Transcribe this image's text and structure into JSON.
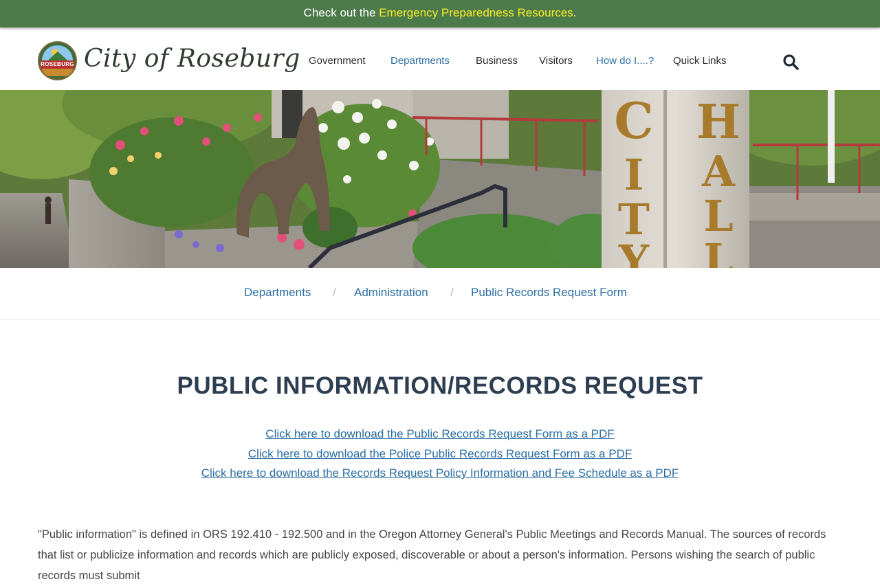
{
  "alert": {
    "prefix": "Check out the ",
    "link": "Emergency Preparedness Resources",
    "suffix": "."
  },
  "logo": {
    "seal_text": "ROSEBURG",
    "title": "City of Roseburg"
  },
  "nav": {
    "items": [
      {
        "label": "Government"
      },
      {
        "label": "Departments"
      },
      {
        "label": "Business"
      },
      {
        "label": "Visitors"
      },
      {
        "label": "How do I....?"
      },
      {
        "label": "Quick Links"
      }
    ]
  },
  "hero": {
    "sign_letters_left": "CITY",
    "sign_letters_right": "HALL"
  },
  "breadcrumb": {
    "items": [
      "Departments",
      "Administration",
      "Public Records Request Form"
    ],
    "separator": "/"
  },
  "main": {
    "title": "PUBLIC INFORMATION/RECORDS REQUEST",
    "links": [
      "Click here to download the Public Records Request Form as a PDF",
      "Click here to download the Police Public Records Request Form as a PDF",
      "Click here to download the Records Request Policy Information and Fee Schedule as a PDF"
    ],
    "paragraph": "\"Public information\" is defined in ORS 192.410 - 192.500 and in the Oregon Attorney General's Public Meetings and Records Manual. The sources of records that list or publicize information and records which are publicly exposed, discoverable or about a person's information. Persons wishing the search of public records must submit"
  },
  "colors": {
    "alert_bg": "#4d7a4a",
    "alert_link": "#f6ec27",
    "link_blue": "#2b6ea3",
    "title_navy": "#2d3e50"
  },
  "icons": {
    "search": "search-icon"
  }
}
